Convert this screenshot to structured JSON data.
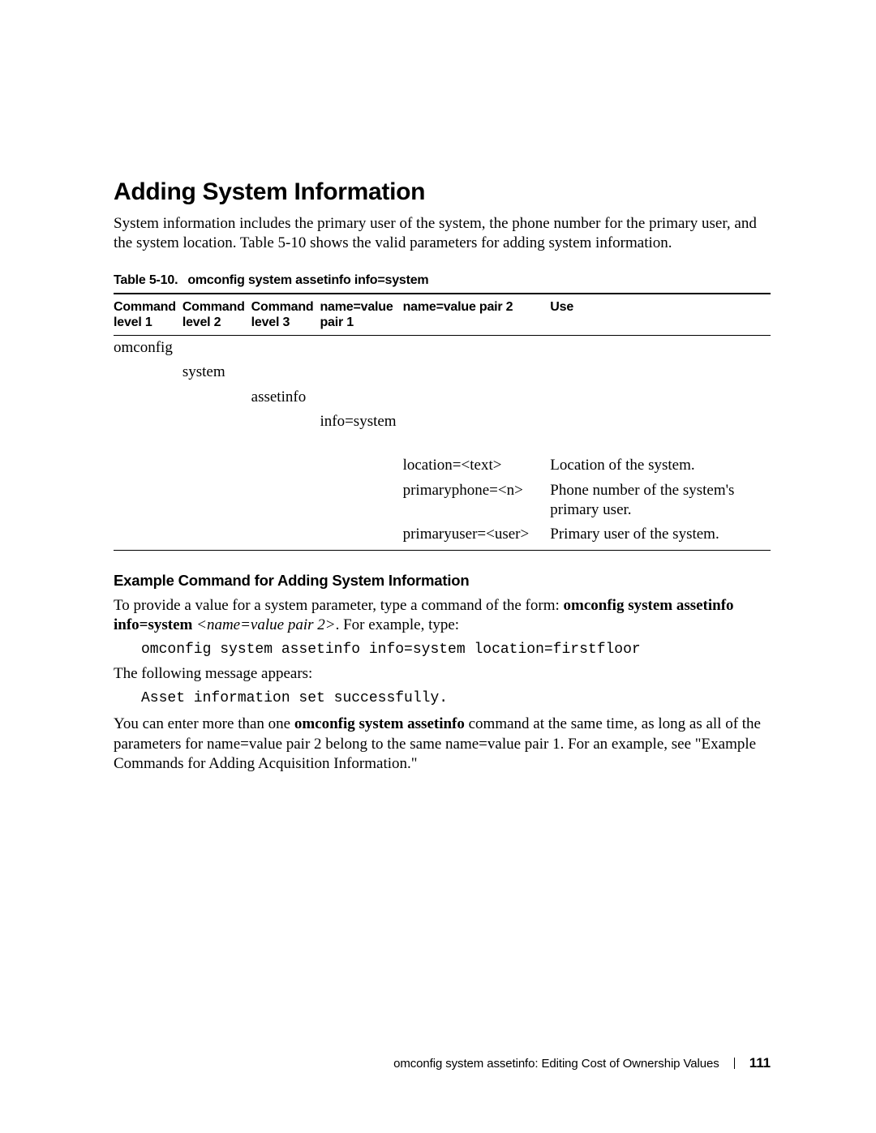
{
  "heading": "Adding System Information",
  "intro": "System information includes the primary user of the system, the phone number for the primary user, and the system location. Table 5-10 shows the valid parameters for adding system information.",
  "table": {
    "caption_num": "Table 5-10.",
    "caption_title": "omconfig system assetinfo info=system",
    "headers": {
      "c1a": "Command",
      "c1b": "level 1",
      "c2a": "Command",
      "c2b": "level 2",
      "c3a": "Command",
      "c3b": "level 3",
      "c4a": "name=value",
      "c4b": "pair 1",
      "c5": "name=value pair 2",
      "c6": "Use"
    },
    "rows": {
      "r1c1": "omconfig",
      "r2c2": "system",
      "r3c3": "assetinfo",
      "r4c4": "info=system",
      "r5c5": "location=<text>",
      "r5c6": "Location of the system.",
      "r6c5": "primaryphone=<n>",
      "r6c6": "Phone number of the system's primary user.",
      "r7c5": "primaryuser=<user>",
      "r7c6": "Primary user of the system."
    }
  },
  "subhead": "Example Command for Adding System Information",
  "example": {
    "lead": "To provide a value for a system parameter, type a command of the form: ",
    "cmd_bold": "omconfig system assetinfo info=system",
    "nv_italic": " <name=value pair 2>",
    "tail": ". For example, type:",
    "code1": "omconfig system assetinfo info=system location=firstfloor",
    "msg_lead": "The following message appears:",
    "code2": "Asset information set successfully."
  },
  "closing": {
    "a": "You can enter more than one ",
    "b": "omconfig system assetinfo",
    "c": " command at the same time, as long as all of the parameters for name=value pair 2 belong to the same name=value pair 1. For an example, see \"Example Commands for Adding Acquisition Information.\""
  },
  "footer": {
    "text": "omconfig system assetinfo: Editing Cost of Ownership Values",
    "page": "111"
  }
}
